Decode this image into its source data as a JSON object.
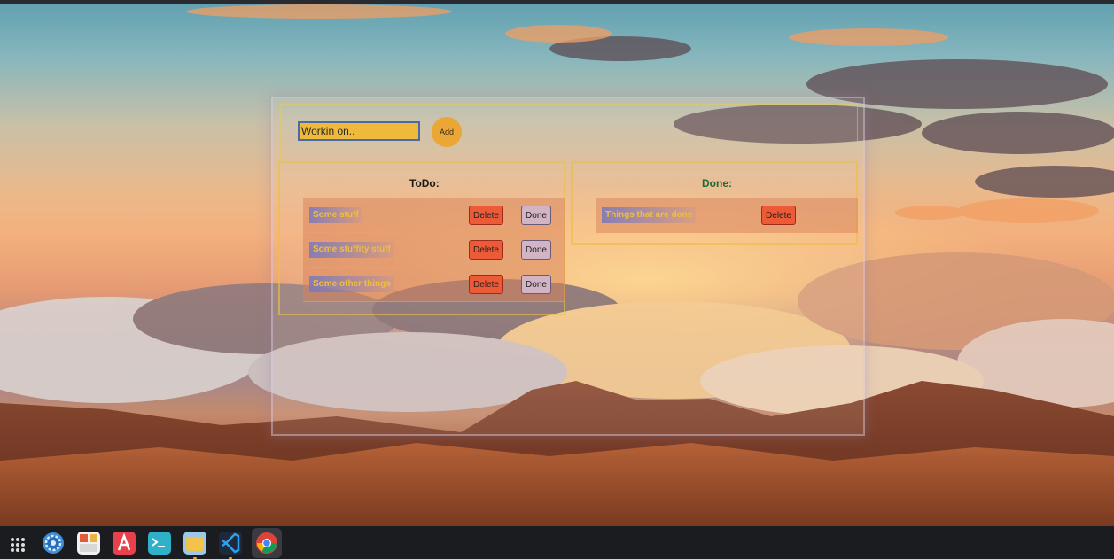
{
  "input": {
    "value": "Workin on..",
    "placeholder": ""
  },
  "add_button": {
    "label": "Add"
  },
  "todo": {
    "title": "ToDo:",
    "items": [
      {
        "label": "Some stuff",
        "delete_label": "Delete",
        "done_label": "Done"
      },
      {
        "label": "Some stuffity stuff",
        "delete_label": "Delete",
        "done_label": "Done"
      },
      {
        "label": "Some other things",
        "delete_label": "Delete",
        "done_label": "Done"
      }
    ]
  },
  "done": {
    "title": "Done:",
    "items": [
      {
        "label": "Things that are done",
        "delete_label": "Delete"
      }
    ]
  },
  "dock": {
    "icons": [
      "apps-grid-icon",
      "settings-icon",
      "system-monitor-icon",
      "app-store-icon",
      "terminal-icon",
      "files-icon",
      "vscode-icon",
      "chrome-icon"
    ]
  },
  "colors": {
    "accent_yellow": "#efb93b",
    "delete_red": "#ec5a37",
    "done_title_green": "#1f6a31"
  }
}
